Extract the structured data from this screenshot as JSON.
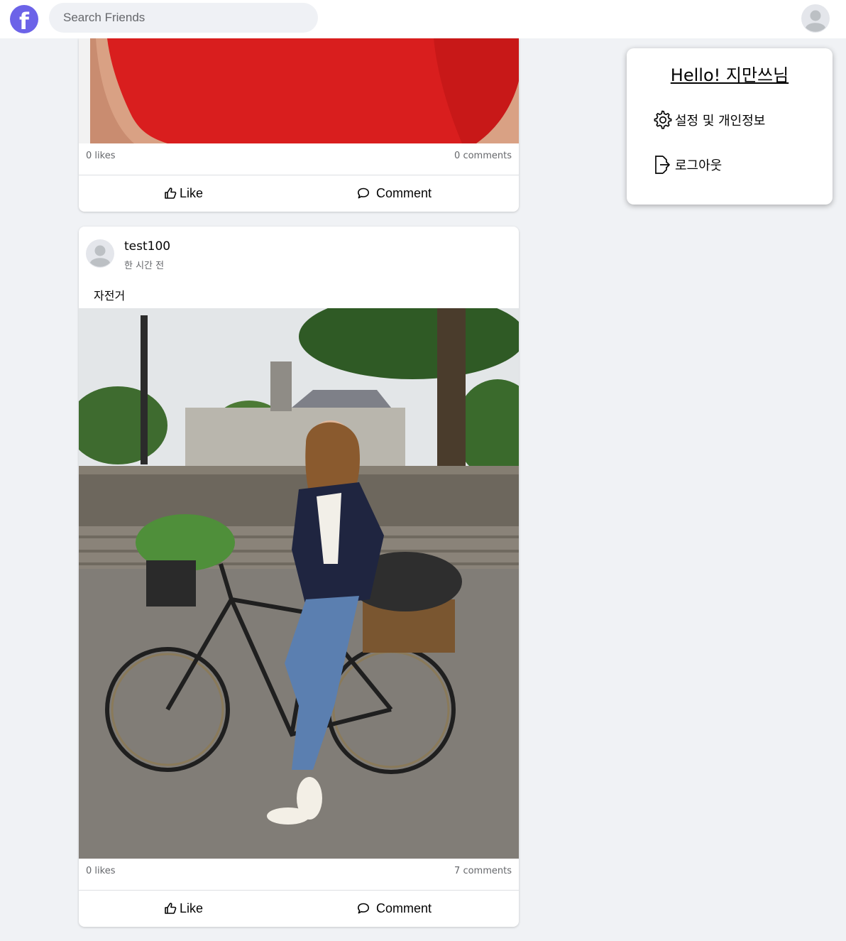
{
  "header": {
    "logo_letter": "f",
    "search_placeholder": "Search Friends"
  },
  "colors": {
    "brand": "#6c63e8",
    "background": "#f0f2f5",
    "card": "#ffffff",
    "secondary_text": "#65676b"
  },
  "posts": [
    {
      "likes": "0 likes",
      "comments": "0 comments",
      "like_label": "Like",
      "comment_label": "Comment",
      "image": "red-shirt-cropped"
    },
    {
      "username": "test100",
      "time": "한 시간 전",
      "text": "자전거",
      "image": "woman-on-bicycle-with-dog",
      "likes": "0 likes",
      "comments": "7 comments",
      "like_label": "Like",
      "comment_label": "Comment"
    }
  ],
  "account_menu": {
    "greeting": "Hello! 지만쓰님",
    "items": [
      {
        "label": "설정 및 개인정보",
        "icon": "gear-icon"
      },
      {
        "label": "로그아웃",
        "icon": "logout-icon"
      }
    ]
  }
}
